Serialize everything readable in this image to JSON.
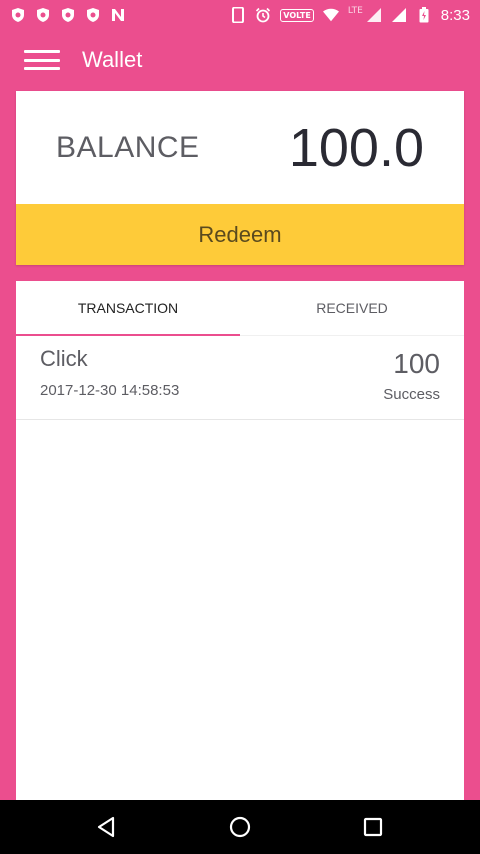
{
  "status_bar": {
    "network_label": "VOLTE",
    "lte_label": "LTE",
    "time": "8:33"
  },
  "app_bar": {
    "title": "Wallet"
  },
  "balance": {
    "label": "BALANCE",
    "value": "100.0",
    "redeem_label": "Redeem"
  },
  "tabs": [
    {
      "label": "TRANSACTION",
      "active": true
    },
    {
      "label": "RECEIVED",
      "active": false
    }
  ],
  "transactions": [
    {
      "name": "Click",
      "date": "2017-12-30 14:58:53",
      "amount": "100",
      "status": "Success"
    }
  ],
  "colors": {
    "primary": "#eb4e8e",
    "accent": "#fecb39",
    "text": "#5d5d63"
  },
  "icons": {
    "menu": "menu-icon",
    "back": "back-icon",
    "home": "home-icon",
    "recents": "recents-icon"
  }
}
